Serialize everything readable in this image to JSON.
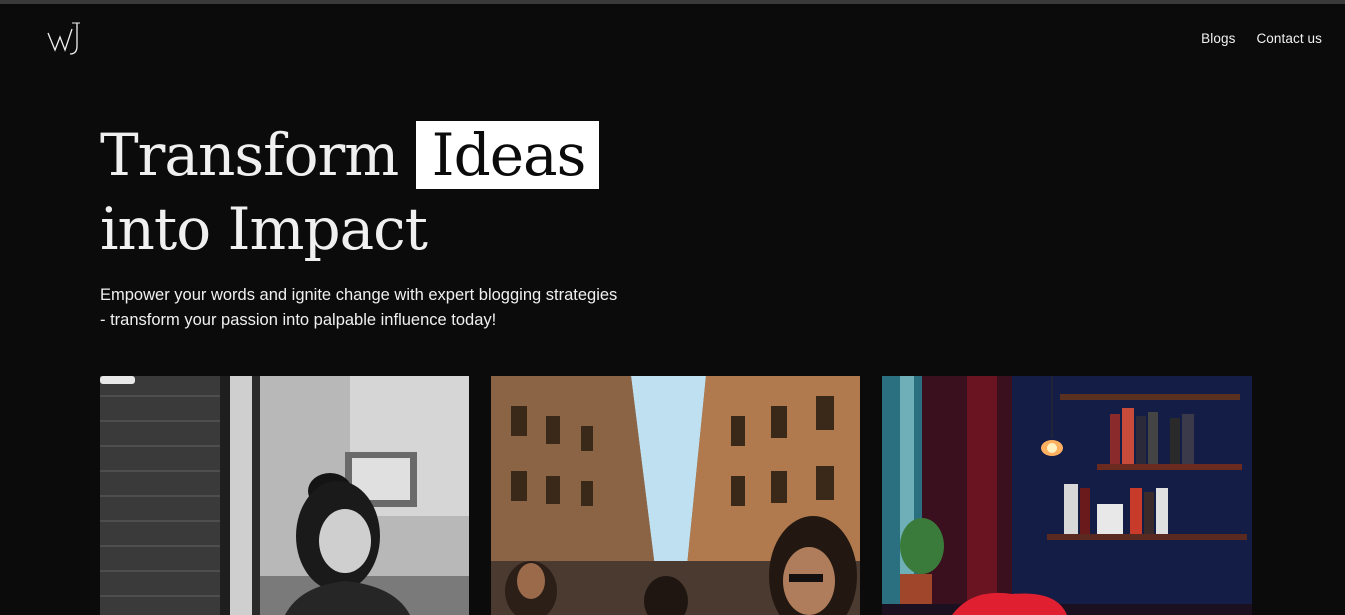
{
  "brand": {
    "logo_text": "WJ",
    "logo_icon": "monogram-logo"
  },
  "nav": {
    "items": [
      {
        "label": "Blogs"
      },
      {
        "label": "Contact us"
      }
    ]
  },
  "hero": {
    "title_part1": "Transform",
    "title_highlight": "Ideas",
    "title_line2": "into Impact",
    "subtitle_line1": "Empower your words and ignite change with expert blogging strategies",
    "subtitle_line2": "- transform your passion into palpable influence today!"
  },
  "cards": [
    {
      "image": "woman-writing-cafe-photo"
    },
    {
      "image": "busy-city-street-photo"
    },
    {
      "image": "cozy-dark-room-bookshelf-photo"
    }
  ],
  "colors": {
    "background": "#0b0b0b",
    "text": "#f2f2f2",
    "highlight_bg": "#ffffff"
  }
}
